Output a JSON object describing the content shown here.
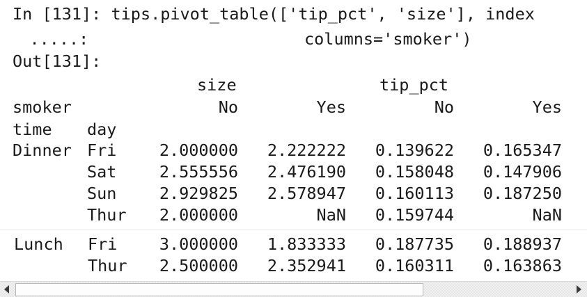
{
  "input": {
    "prompt": "In [131]:",
    "code_line1": "tips.pivot_table(['tip_pct', 'size'], index",
    "continuation_prompt": "   .....:",
    "code_line2": "columns='smoker')"
  },
  "output": {
    "prompt": "Out[131]:",
    "column_groups": [
      "size",
      "tip_pct"
    ],
    "columns_index_name": "smoker",
    "column_labels": [
      "No",
      "Yes",
      "No",
      "Yes"
    ],
    "row_index_names": [
      "time",
      "day"
    ],
    "rows": [
      {
        "time": "Dinner",
        "day": "Fri",
        "values": [
          "2.000000",
          "2.222222",
          "0.139622",
          "0.165347"
        ]
      },
      {
        "time": "",
        "day": "Sat",
        "values": [
          "2.555556",
          "2.476190",
          "0.158048",
          "0.147906"
        ]
      },
      {
        "time": "",
        "day": "Sun",
        "values": [
          "2.929825",
          "2.578947",
          "0.160113",
          "0.187250"
        ]
      },
      {
        "time": "",
        "day": "Thur",
        "values": [
          "2.000000",
          "NaN",
          "0.159744",
          "NaN"
        ]
      },
      {
        "time": "Lunch",
        "day": "Fri",
        "values": [
          "3.000000",
          "1.833333",
          "0.187735",
          "0.188937"
        ]
      },
      {
        "time": "",
        "day": "Thur",
        "values": [
          "2.500000",
          "2.352941",
          "0.160311",
          "0.163863"
        ]
      }
    ]
  },
  "scrollbar": {
    "left_icon": "triangle-left-icon",
    "right_icon": "triangle-right-icon",
    "position": 0.0,
    "visible_fraction": 0.72
  }
}
